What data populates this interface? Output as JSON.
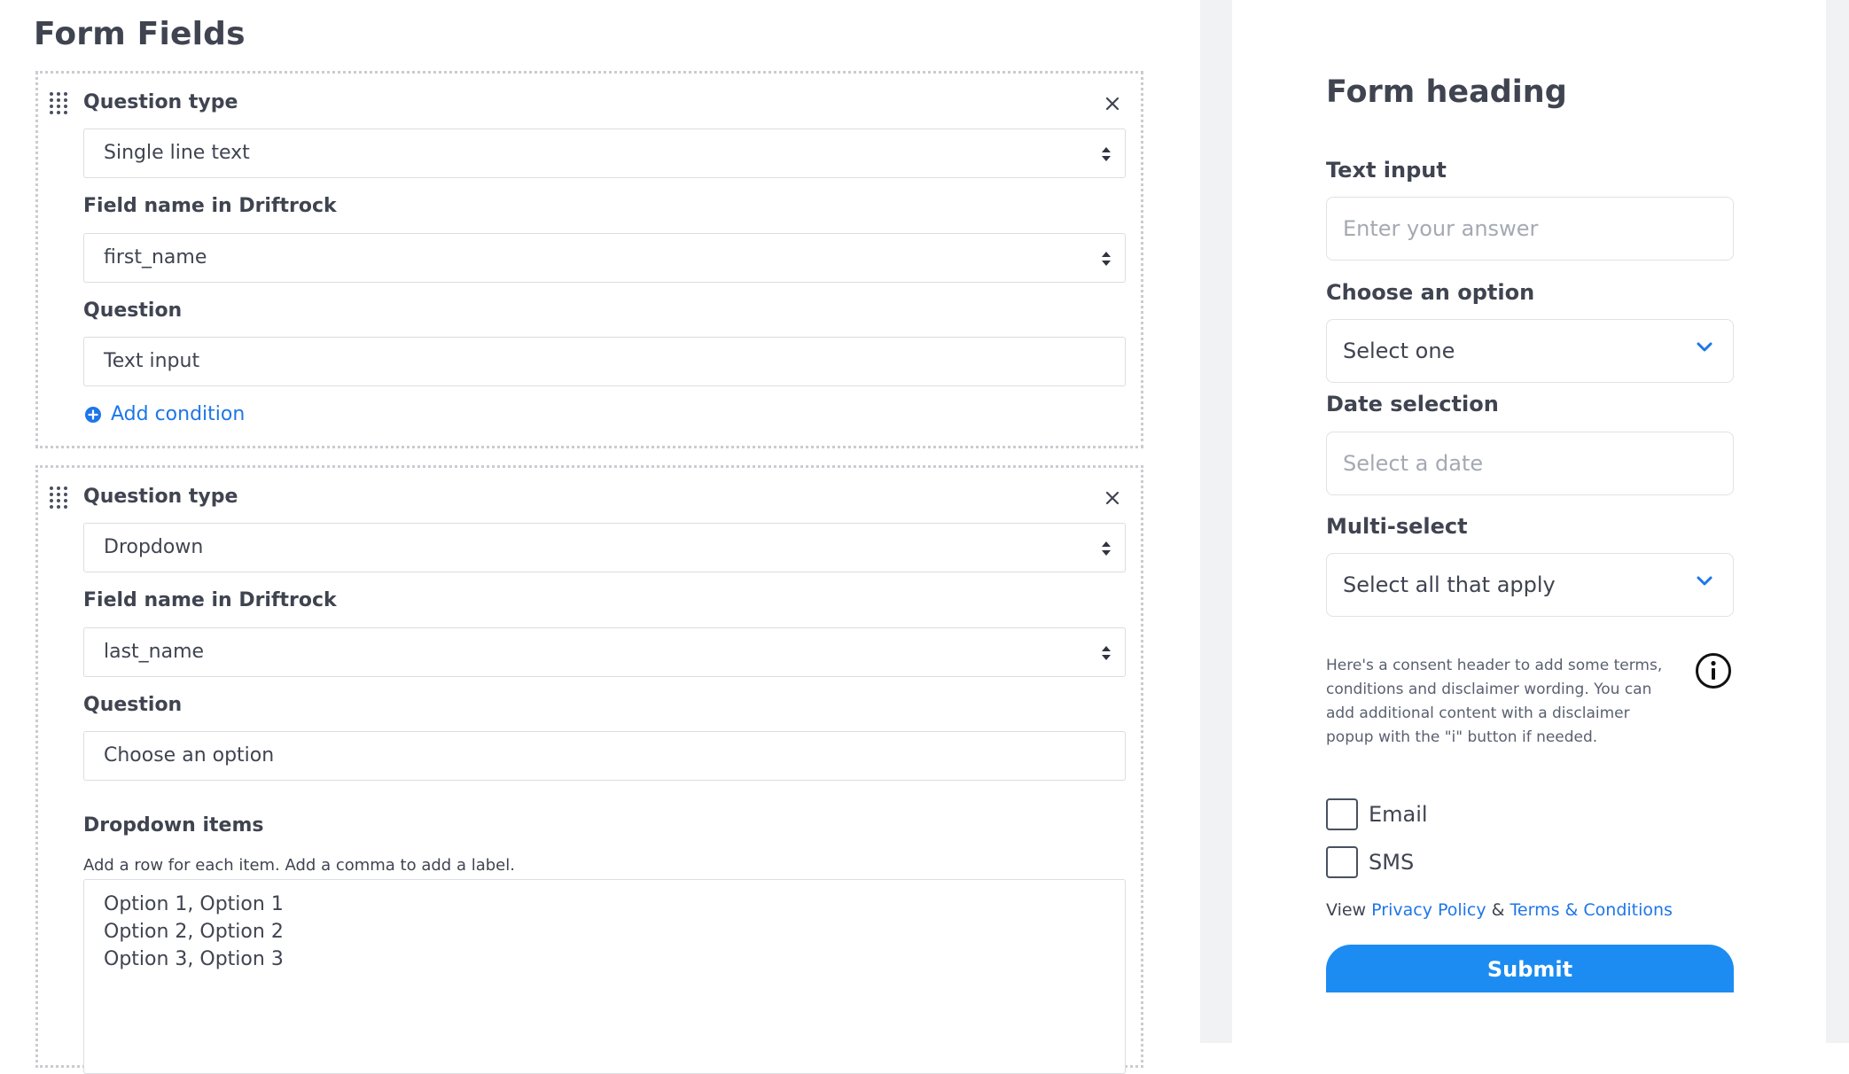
{
  "editor": {
    "title": "Form Fields",
    "card1": {
      "question_type_label": "Question type",
      "question_type_value": "Single line text",
      "field_name_label": "Field name in Driftrock",
      "field_name_value": "first_name",
      "question_label": "Question",
      "question_value": "Text input",
      "add_condition": "Add condition"
    },
    "card2": {
      "question_type_label": "Question type",
      "question_type_value": "Dropdown",
      "field_name_label": "Field name in Driftrock",
      "field_name_value": "last_name",
      "question_label": "Question",
      "question_value": "Choose an option",
      "dropdown_items_label": "Dropdown items",
      "dropdown_items_hint": "Add a row for each item. Add a comma to add a label.",
      "dropdown_items": [
        "Option 1, Option 1",
        "Option 2, Option 2",
        "Option 3, Option 3"
      ]
    }
  },
  "preview": {
    "heading": "Form heading",
    "text_input_label": "Text input",
    "text_input_placeholder": "Enter your answer",
    "choose_label": "Choose an option",
    "choose_value": "Select one",
    "date_label": "Date selection",
    "date_placeholder": "Select a date",
    "multi_label": "Multi-select",
    "multi_value": "Select all that apply",
    "consent_text": "Here's a consent header to add some terms, conditions and disclaimer wording. You can add additional content with a disclaimer popup with the \"i\" button if needed.",
    "checkboxes": [
      "Email",
      "SMS"
    ],
    "view_prefix": "View",
    "privacy_link": "Privacy Policy",
    "ampersand": "&",
    "terms_link": "Terms & Conditions",
    "submit_label": "Submit"
  },
  "colors": {
    "accent": "#1e76e8",
    "submit": "#1d8cf2",
    "text": "#3f4450"
  }
}
